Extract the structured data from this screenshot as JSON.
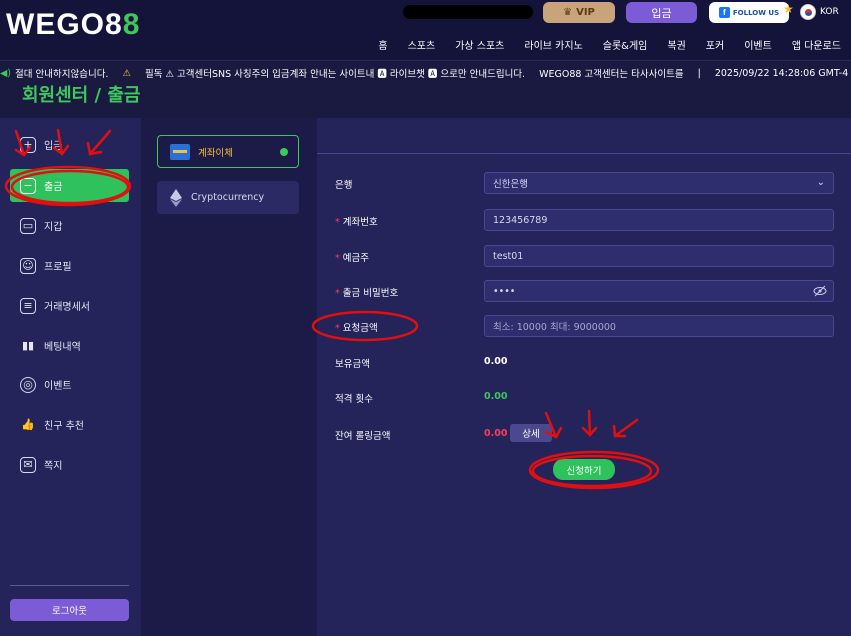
{
  "header": {
    "logo_main": "WEGO8",
    "logo_accent": "8",
    "vip_label": "VIP",
    "deposit_label": "입금",
    "follow_label": "FOLLOW US",
    "lang_label": "KOR",
    "nav": [
      "홈",
      "스포츠",
      "가상 스포츠",
      "라이브 카지노",
      "슬롯&게임",
      "복권",
      "포커",
      "이벤트",
      "앱 다운로드"
    ]
  },
  "ticker": {
    "items": [
      "절대 안내하지않습니다.",
      "필독 ⚠ 고객센터SNS 사칭주의 입금계좌 안내는 사이트내 🅰 라이브챗 🅰 으로만 안내드립니다.",
      "WEGO88 고객센터는 타사사이트를",
      "|",
      "2025/09/22 14:28:06 GMT-4"
    ]
  },
  "page_title": "회원센터 / 출금",
  "sidebar": {
    "items": [
      {
        "label": "입금",
        "icon": "plus-icon"
      },
      {
        "label": "출금",
        "icon": "minus-icon"
      },
      {
        "label": "지갑",
        "icon": "wallet-icon"
      },
      {
        "label": "프로필",
        "icon": "profile-icon"
      },
      {
        "label": "거래명세서",
        "icon": "document-icon"
      },
      {
        "label": "베팅내역",
        "icon": "chart-icon"
      },
      {
        "label": "이벤트",
        "icon": "target-icon"
      },
      {
        "label": "친구 추천",
        "icon": "thumbs-up-icon"
      },
      {
        "label": "쪽지",
        "icon": "mail-icon"
      }
    ],
    "logout_label": "로그아웃"
  },
  "methods": {
    "bank_label": "계좌이체",
    "crypto_label": "Cryptocurrency"
  },
  "form": {
    "bank_label": "은행",
    "bank_value": "신한은행",
    "account_label": "계좌번호",
    "account_value": "123456789",
    "holder_label": "예금주",
    "holder_value": "test01",
    "password_label": "출금 비밀번호",
    "password_value": "••••",
    "amount_label": "요청금액",
    "amount_placeholder": "최소: 10000 최대: 9000000",
    "balance_label": "보유금액",
    "balance_value": "0.00",
    "deposit_count_label": "적격 횟수",
    "deposit_count_value": "0.00",
    "rolling_label": "잔여 롤링금액",
    "rolling_value": "0.00",
    "detail_label": "상세",
    "apply_label": "신청하기"
  },
  "colors": {
    "accent_green": "#2fc25c",
    "accent_purple": "#7b5cd6",
    "required_red": "#ff3b5c",
    "annotation_red": "#e01010"
  }
}
